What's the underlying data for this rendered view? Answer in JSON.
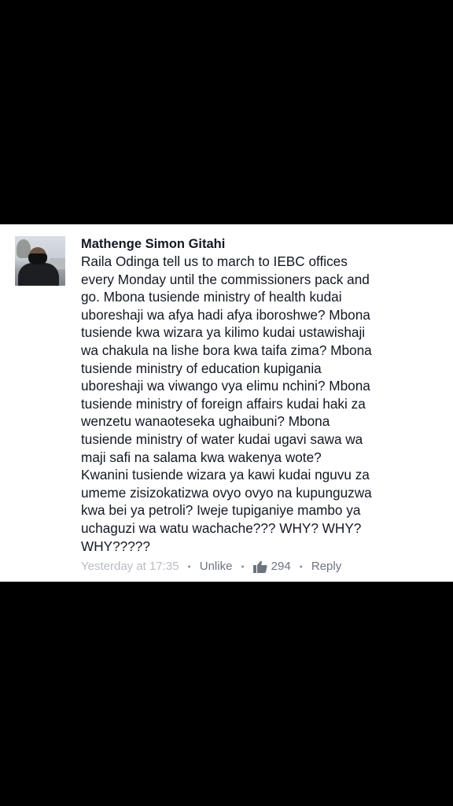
{
  "comment": {
    "author": "Mathenge Simon Gitahi",
    "text": "Raila Odinga tell us to march to IEBC offices every Monday until the commissioners pack and go. Mbona tusiende ministry of health kudai uboreshaji wa afya hadi afya iboroshwe? Mbona tusiende kwa wizara ya kilimo kudai ustawishaji wa chakula na lishe bora kwa taifa zima? Mbona tusiende ministry of education kupigania uboreshaji wa viwango vya elimu nchini? Mbona tusiende ministry of foreign affairs kudai haki za wenzetu wanaoteseka ughaibuni? Mbona tusiende ministry of water kudai ugavi sawa wa maji safi na salama kwa wakenya wote? Kwanini tusiende wizara ya kawi kudai nguvu za umeme zisizokatizwa ovyo ovyo na kupunguzwa kwa bei ya petroli? Iweje tupiganiye mambo ya uchaguzi wa watu wachache??? WHY? WHY? WHY?????",
    "timestamp": "Yesterday at 17:35",
    "separator": "•",
    "unlike_label": "Unlike",
    "like_count": "294",
    "reply_label": "Reply",
    "like_icon": "thumbs-up-icon"
  },
  "colors": {
    "background": "#000000",
    "card": "#ffffff",
    "text": "#141823",
    "meta": "#9197a3"
  }
}
